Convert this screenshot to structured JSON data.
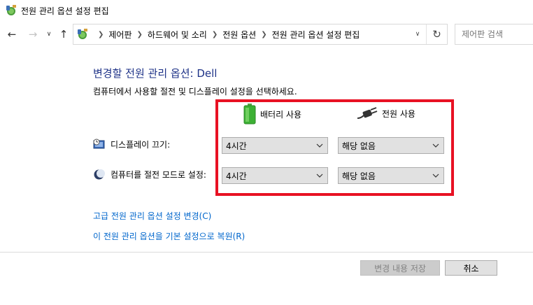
{
  "window": {
    "title": "전원 관리 옵션 설정 편집",
    "icon": "power-options-icon"
  },
  "navigation": {
    "back_icon": "back-arrow-icon",
    "forward_icon": "forward-arrow-icon",
    "recent_icon": "chevron-down-icon",
    "up_icon": "up-arrow-icon",
    "address_icon": "control-panel-icon",
    "breadcrumbs": [
      "제어판",
      "하드웨어 및 소리",
      "전원 옵션",
      "전원 관리 옵션 설정 편집"
    ],
    "dropdown_icon": "chevron-down-icon",
    "refresh_icon": "refresh-icon"
  },
  "search": {
    "placeholder": "제어판 검색",
    "value": ""
  },
  "main": {
    "heading": "변경할 전원 관리 옵션: Dell",
    "description": "컴퓨터에서 사용할 절전 및 디스플레이 설정을 선택하세요.",
    "columns": {
      "battery": {
        "label": "배터리 사용",
        "icon": "battery-icon"
      },
      "plugged": {
        "label": "전원 사용",
        "icon": "power-plug-icon"
      }
    },
    "rows": [
      {
        "label": "디스플레이 끄기:",
        "icon": "monitor-clock-icon",
        "battery": "4시간",
        "plugged": "해당 없음"
      },
      {
        "label": "컴퓨터를 절전 모드로 설정:",
        "icon": "moon-icon",
        "battery": "4시간",
        "plugged": "해당 없음"
      }
    ],
    "links": {
      "advanced": "고급 전원 관리 옵션 설정 변경(C)",
      "restore": "이 전원 관리 옵션을 기본 설정으로 복원(R)"
    }
  },
  "footer": {
    "save_label": "변경 내용 저장",
    "cancel_label": "취소"
  },
  "colors": {
    "heading": "#1e3287",
    "link": "#0066cc",
    "highlight_border": "#e81123",
    "battery_green": "#3cb034"
  }
}
